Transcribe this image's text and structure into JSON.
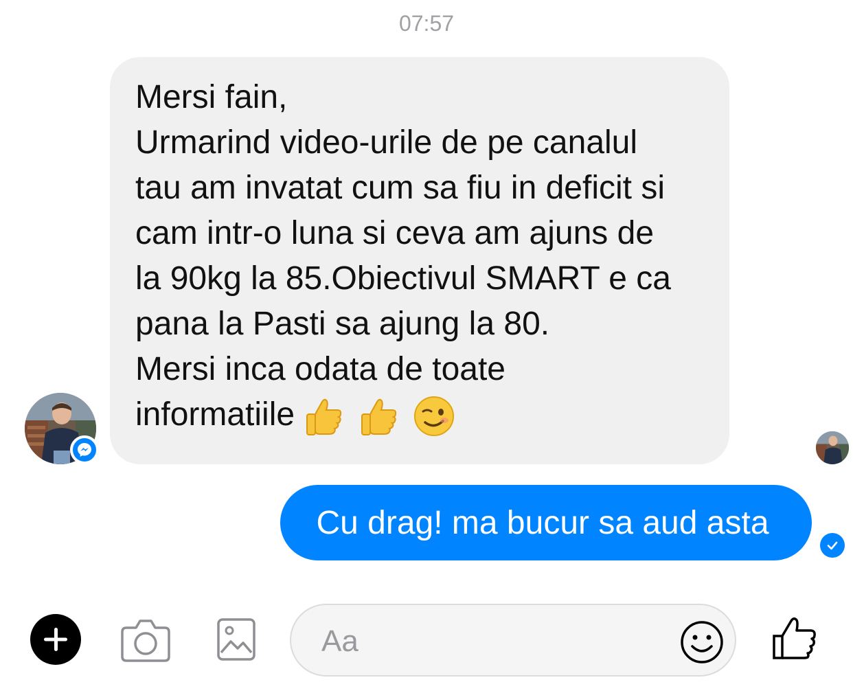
{
  "conversation": {
    "timestamp": "07:57",
    "incoming_message": {
      "lines": [
        "Mersi fain,",
        "Urmarind video-urile de pe canalul",
        "tau am invatat cum sa fiu in deficit si",
        "cam intr-o luna si ceva am ajuns de",
        "la 90kg la 85.Obiectivul SMART e ca",
        "pana la Pasti sa ajung la 80.",
        "Mersi inca odata de toate"
      ],
      "last_line": "informatiile",
      "emojis": [
        "thumbs-up-emoji",
        "thumbs-up-emoji",
        "winking-face-emoji"
      ]
    },
    "outgoing_message": {
      "text": "Cu drag! ma bucur sa aud asta",
      "status": "sent"
    }
  },
  "composer": {
    "placeholder": "Aa",
    "icons": [
      "plus-icon",
      "camera-icon",
      "image-icon",
      "emoji-icon",
      "like-icon"
    ]
  },
  "colors": {
    "accent": "#0084ff",
    "incoming_bubble": "#f0f0f0",
    "timestamp": "#a0a0a5"
  }
}
